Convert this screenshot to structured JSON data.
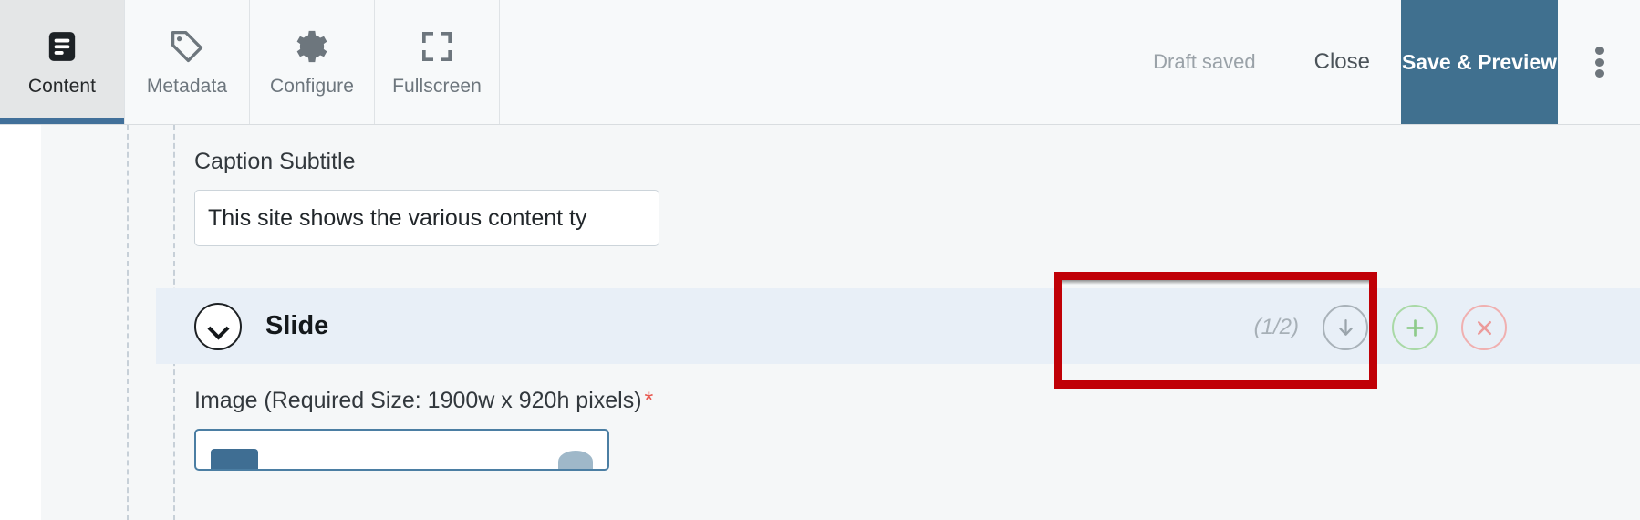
{
  "toolbar": {
    "tabs": [
      {
        "label": "Content",
        "icon": "document-lines-icon",
        "active": true
      },
      {
        "label": "Metadata",
        "icon": "tag-icon",
        "active": false
      },
      {
        "label": "Configure",
        "icon": "gear-icon",
        "active": false
      },
      {
        "label": "Fullscreen",
        "icon": "fullscreen-icon",
        "active": false
      }
    ],
    "status_text": "Draft saved",
    "close_label": "Close",
    "save_preview_label": "Save & Preview",
    "overflow_icon": "kebab-menu-icon",
    "accent_color": "#40708f",
    "active_tab_bg": "#e4e6e7",
    "active_tab_underline": "#41709a"
  },
  "form": {
    "caption_subtitle": {
      "label": "Caption Subtitle",
      "value": "This site shows the various content ty",
      "placeholder": ""
    },
    "image_field": {
      "label": "Image (Required Size: 1900w x 920h pixels)",
      "required_marker": "*",
      "required_color": "#e8554d"
    }
  },
  "slide_section": {
    "title": "Slide",
    "collapse_icon": "chevron-down-icon",
    "band_color": "#e8eff7",
    "controls": {
      "counter": "(1/2)",
      "move_down": {
        "icon": "arrow-down-circle-icon",
        "color": "#a9b2b9"
      },
      "add": {
        "icon": "plus-circle-icon",
        "color": "#a9d9a6"
      },
      "remove": {
        "icon": "x-circle-icon",
        "color": "#f0b0b0"
      }
    }
  },
  "annotation": {
    "highlight_color": "#c00007",
    "target": "slide-controls-group"
  }
}
